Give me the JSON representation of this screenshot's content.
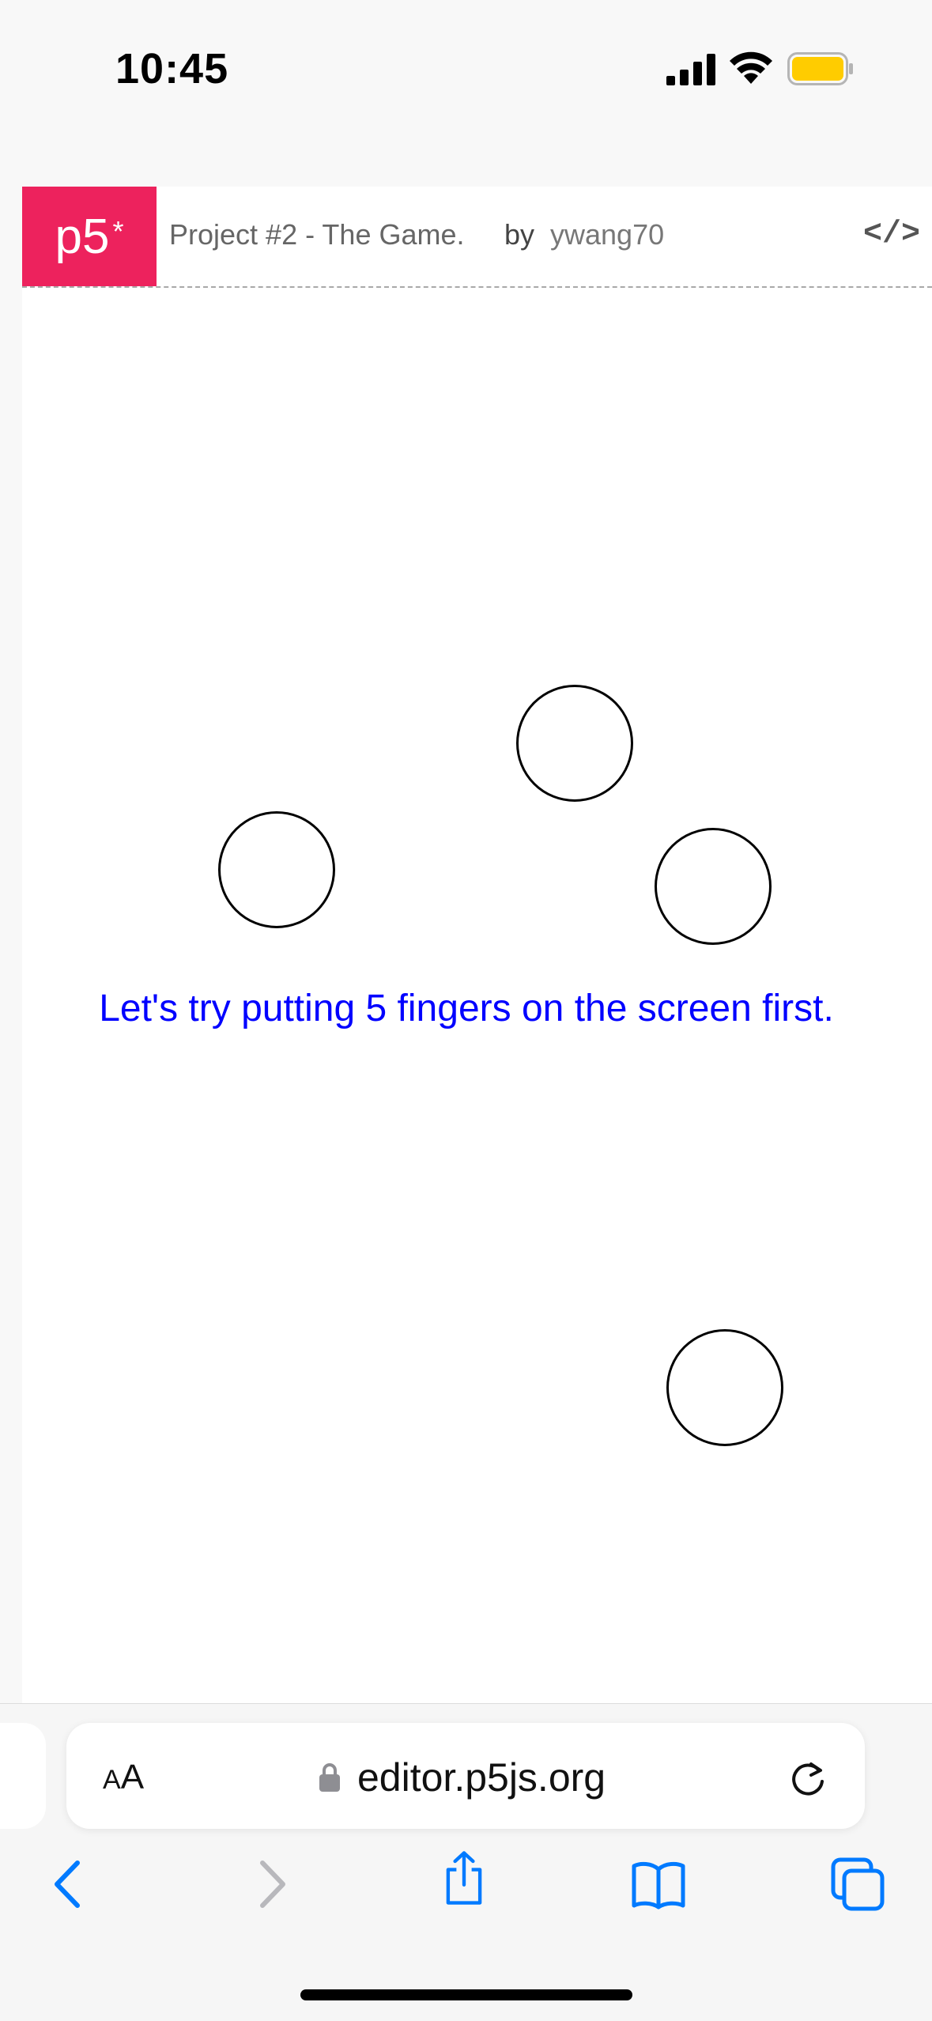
{
  "status_bar": {
    "time": "10:45"
  },
  "project": {
    "logo_text": "p5",
    "logo_star": "*",
    "title": "Project #2 - The Game.",
    "by": "by",
    "author": "ywang70",
    "code_label": "</>"
  },
  "canvas": {
    "instruction": "Let's try putting 5 fingers on the screen first.",
    "instruction_color": "#0000ff",
    "circle_count": 4
  },
  "browser": {
    "text_size_small": "A",
    "text_size_large": "A",
    "url": "editor.p5js.org"
  },
  "colors": {
    "p5_brand": "#ed225d",
    "ios_blue": "#007aff",
    "battery": "#ffcc00"
  },
  "icons": {
    "signal": "signal-icon",
    "wifi": "wifi-icon",
    "battery": "battery-icon",
    "lock": "lock-icon",
    "reload": "reload-icon",
    "back": "chevron-left-icon",
    "forward": "chevron-right-icon",
    "share": "share-icon",
    "bookmarks": "book-icon",
    "tabs": "tabs-icon",
    "code": "code-icon"
  }
}
